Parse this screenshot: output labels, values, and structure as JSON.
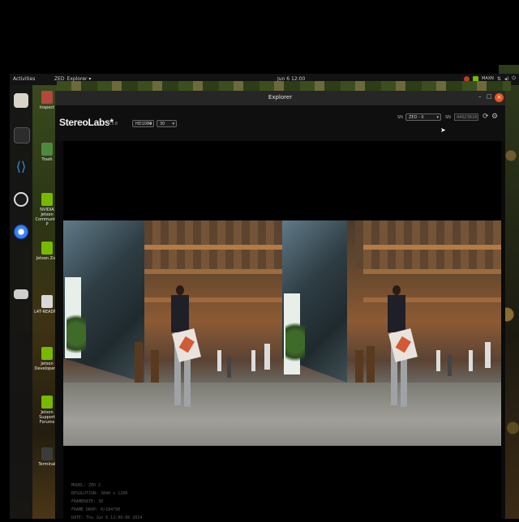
{
  "topbar": {
    "activities": "Activities",
    "app_menu": "ZED_Explorer ▾",
    "clock": "Jun 6 12:00",
    "tray_label": "MAXN"
  },
  "desktop_icons": [
    {
      "label": "Inspect",
      "color": "#b04a3a"
    },
    {
      "label": "Trash",
      "color": "#4d8a3d"
    },
    {
      "label": "NVIDIA Jetson Community P",
      "color": "#76b900"
    },
    {
      "label": "Jetson Zoo",
      "color": "#76b900"
    },
    {
      "label": "L4T-README",
      "color": "#d8d8d8"
    },
    {
      "label": "Jetson Developer Z",
      "color": "#76b900"
    },
    {
      "label": "Jetson Support Forums",
      "color": "#76b900"
    },
    {
      "label": "Terminal",
      "color": "#3b3b3b"
    }
  ],
  "window": {
    "title": "Explorer",
    "minimize": "–",
    "maximize": "□",
    "close": "×"
  },
  "toolbar": {
    "logo": "StereoLabs*",
    "version": "v.3.8",
    "resolution": "HD1080",
    "fps": "30",
    "camera_label": "SN",
    "camera_model": "ZED - 0",
    "serial_label": "SN",
    "serial": "44023616"
  },
  "info": {
    "lines": [
      "MODEL: ZED 2",
      "RESOLUTION: 3840 x 1280",
      "FRAMERATE: 30",
      "FRAME DROP: 0/184790",
      "DATE: Thu Jun 6 12:00:00 2024"
    ]
  },
  "colors": {
    "accent": "#e95420",
    "nvidia": "#76b900",
    "window_bg": "#0b0b0b"
  }
}
